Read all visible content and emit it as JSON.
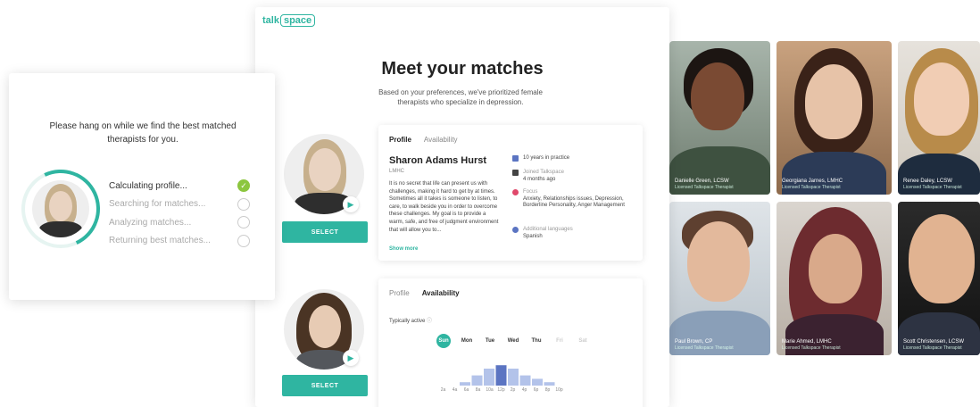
{
  "brand": {
    "prefix": "talk",
    "boxed": "space"
  },
  "main": {
    "title": "Meet your matches",
    "subtitle": "Based on your preferences, we've prioritized female therapists who specialize in depression."
  },
  "therapist1": {
    "tabs": [
      "Profile",
      "Availability"
    ],
    "active_tab": "Profile",
    "name": "Sharon Adams Hurst",
    "credentials": "LMHC",
    "bio": "It is no secret that life can present us with challenges, making it hard to get by at times. Sometimes all it takes is someone to listen, to care, to walk beside you in order to overcome these challenges. My goal is to provide a warm, safe, and free of judgment environment that will allow you to...",
    "show_more": "Show more",
    "experience": "10 years in practice",
    "joined_label": "Joined Talkspace",
    "joined_value": "4 months ago",
    "focus_label": "Focus",
    "focus_value": "Anxiety, Relationships issues, Depression, Borderline Personality, Anger Management",
    "languages_label": "Additional languages",
    "languages_value": "Spanish",
    "select_label": "SELECT"
  },
  "therapist2": {
    "tabs": [
      "Profile",
      "Availability"
    ],
    "active_tab": "Availability",
    "typically_active": "Typically active",
    "days": [
      "Sun",
      "Mon",
      "Tue",
      "Wed",
      "Thu",
      "Fri",
      "Sat"
    ],
    "selected_day": "Sun",
    "hours": [
      "2a",
      "4a",
      "6a",
      "8a",
      "10a",
      "12p",
      "2p",
      "4p",
      "6p",
      "8p",
      "10p"
    ],
    "activity": [
      0,
      0,
      0.1,
      0.3,
      0.5,
      0.6,
      0.5,
      0.3,
      0.2,
      0.1,
      0
    ],
    "select_label": "SELECT"
  },
  "loading": {
    "title": "Please hang on while we find the best matched therapists for you.",
    "steps": [
      {
        "label": "Calculating profile...",
        "done": true
      },
      {
        "label": "Searching for matches...",
        "done": false
      },
      {
        "label": "Analyzing matches...",
        "done": false
      },
      {
        "label": "Returning best matches...",
        "done": false
      }
    ]
  },
  "gallery": [
    {
      "name": "Danielle Green, LCSW",
      "role": "Licensed Talkspace Therapist"
    },
    {
      "name": "Georgiana Jarnes, LMHC",
      "role": "Licensed Talkspace Therapist"
    },
    {
      "name": "Renee Daley, LCSW",
      "role": "Licensed Talkspace Therapist"
    },
    {
      "name": "Paul Brown, CP",
      "role": "Licensed Talkspace Therapist"
    },
    {
      "name": "Marie Ahmed, LMHC",
      "role": "Licensed Talkspace Therapist"
    },
    {
      "name": "Scott Christensen, LCSW",
      "role": "Licensed Talkspace Therapist"
    }
  ],
  "colors": {
    "accent": "#2fb5a1",
    "check": "#8cc63f",
    "chart": "#b3c3ea",
    "chart_peak": "#5b74c2"
  }
}
